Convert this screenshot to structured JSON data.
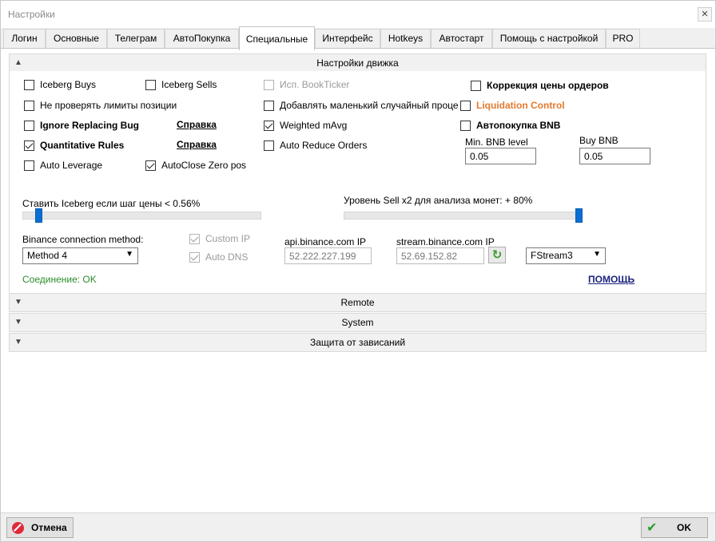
{
  "window": {
    "title": "Настройки",
    "close_glyph": "✕"
  },
  "tabs": [
    {
      "label": "Логин"
    },
    {
      "label": "Основные"
    },
    {
      "label": "Телеграм"
    },
    {
      "label": "АвтоПокупка"
    },
    {
      "label": "Специальные",
      "active": true
    },
    {
      "label": "Интерфейс"
    },
    {
      "label": "Hotkeys"
    },
    {
      "label": "Автостарт"
    },
    {
      "label": "Помощь с настройкой"
    },
    {
      "label": "PRO"
    }
  ],
  "engine": {
    "header": "Настройки движка",
    "checkboxes": {
      "iceberg_buys": {
        "label": "Iceberg Buys",
        "checked": false
      },
      "iceberg_sells": {
        "label": "Iceberg Sells",
        "checked": false
      },
      "use_bookticker": {
        "label": "Исп. BookTicker",
        "checked": false,
        "disabled": true
      },
      "price_correction": {
        "label": "Коррекция цены ордеров",
        "checked": false
      },
      "no_position_limits": {
        "label": "Не проверять лимиты позиции",
        "checked": false
      },
      "add_random": {
        "label": "Добавлять маленький случайный проце",
        "checked": false
      },
      "liquidation_control": {
        "label": "Liquidation Control",
        "checked": false
      },
      "ignore_replacing_bug": {
        "label": "Ignore Replacing Bug",
        "checked": false
      },
      "weighted_mavg": {
        "label": "Weighted mAvg",
        "checked": true
      },
      "auto_buy_bnb": {
        "label": "Автопокупка BNB",
        "checked": false
      },
      "quantitative_rules": {
        "label": "Quantitative Rules",
        "checked": true
      },
      "auto_reduce_orders": {
        "label": "Auto Reduce Orders",
        "checked": false
      },
      "auto_leverage": {
        "label": "Auto Leverage",
        "checked": false
      },
      "autoclose_zero_pos": {
        "label": "AutoClose Zero pos",
        "checked": true
      }
    },
    "help_link_1": "Справка",
    "help_link_2": "Справка",
    "min_bnb_label": "Min. BNB level",
    "min_bnb_value": "0.05",
    "buy_bnb_label": "Buy BNB",
    "buy_bnb_value": "0.05",
    "iceberg_slider": {
      "label": "Ставить Iceberg если шаг цены < 0.56%",
      "value": 0.56
    },
    "sellx2_slider": {
      "label": "Уровень Sell x2 для анализа монет: + 80%",
      "value": 80
    },
    "connection_method_label": "Binance connection method:",
    "connection_method_value": "Method 4",
    "custom_ip": {
      "label": "Custom IP",
      "checked": true,
      "disabled": true
    },
    "auto_dns": {
      "label": "Auto DNS",
      "checked": true,
      "disabled": true
    },
    "api_ip_label": "api.binance.com IP",
    "api_ip_value": "52.222.227.199",
    "stream_ip_label": "stream.binance.com IP",
    "stream_ip_value": "52.69.152.82",
    "stream_select_value": "FStream3",
    "connection_status": "Соединение:  OK",
    "help_button": "ПОМОЩЬ"
  },
  "sections": {
    "remote": "Remote",
    "system": "System",
    "hang_protection": "Защита от зависаний"
  },
  "footer": {
    "cancel_label": "Отмена",
    "ok_label": "OK"
  },
  "colors": {
    "accent_slider": "#0a6fd3",
    "liquidation_orange": "#e47a2d",
    "status_green": "#2b8c2b",
    "help_link_blue": "#1a237e"
  }
}
